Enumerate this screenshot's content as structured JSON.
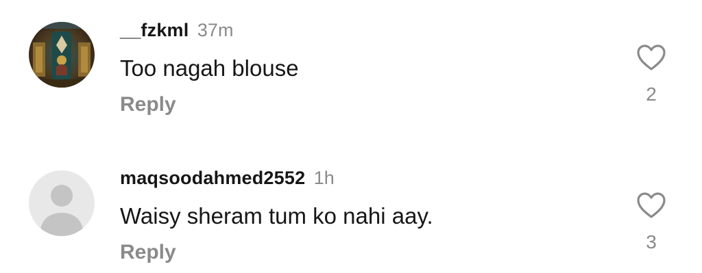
{
  "comments": [
    {
      "username": "__fzkml",
      "time": "37m",
      "text": "Too nagah blouse",
      "reply_label": "Reply",
      "like_count": "2",
      "avatar": "photo-avatar"
    },
    {
      "username": "maqsoodahmed2552",
      "time": "1h",
      "text": "Waisy sheram tum ko nahi aay.",
      "reply_label": "Reply",
      "like_count": "3",
      "avatar": "default-person-avatar"
    }
  ],
  "icons": {
    "like": "heart-outline-icon"
  },
  "colors": {
    "username": "#161616",
    "secondary_text": "#8a8a8a",
    "avatar_placeholder_bg": "#e8e8e8",
    "avatar_placeholder_fg": "#c4c4c4"
  }
}
